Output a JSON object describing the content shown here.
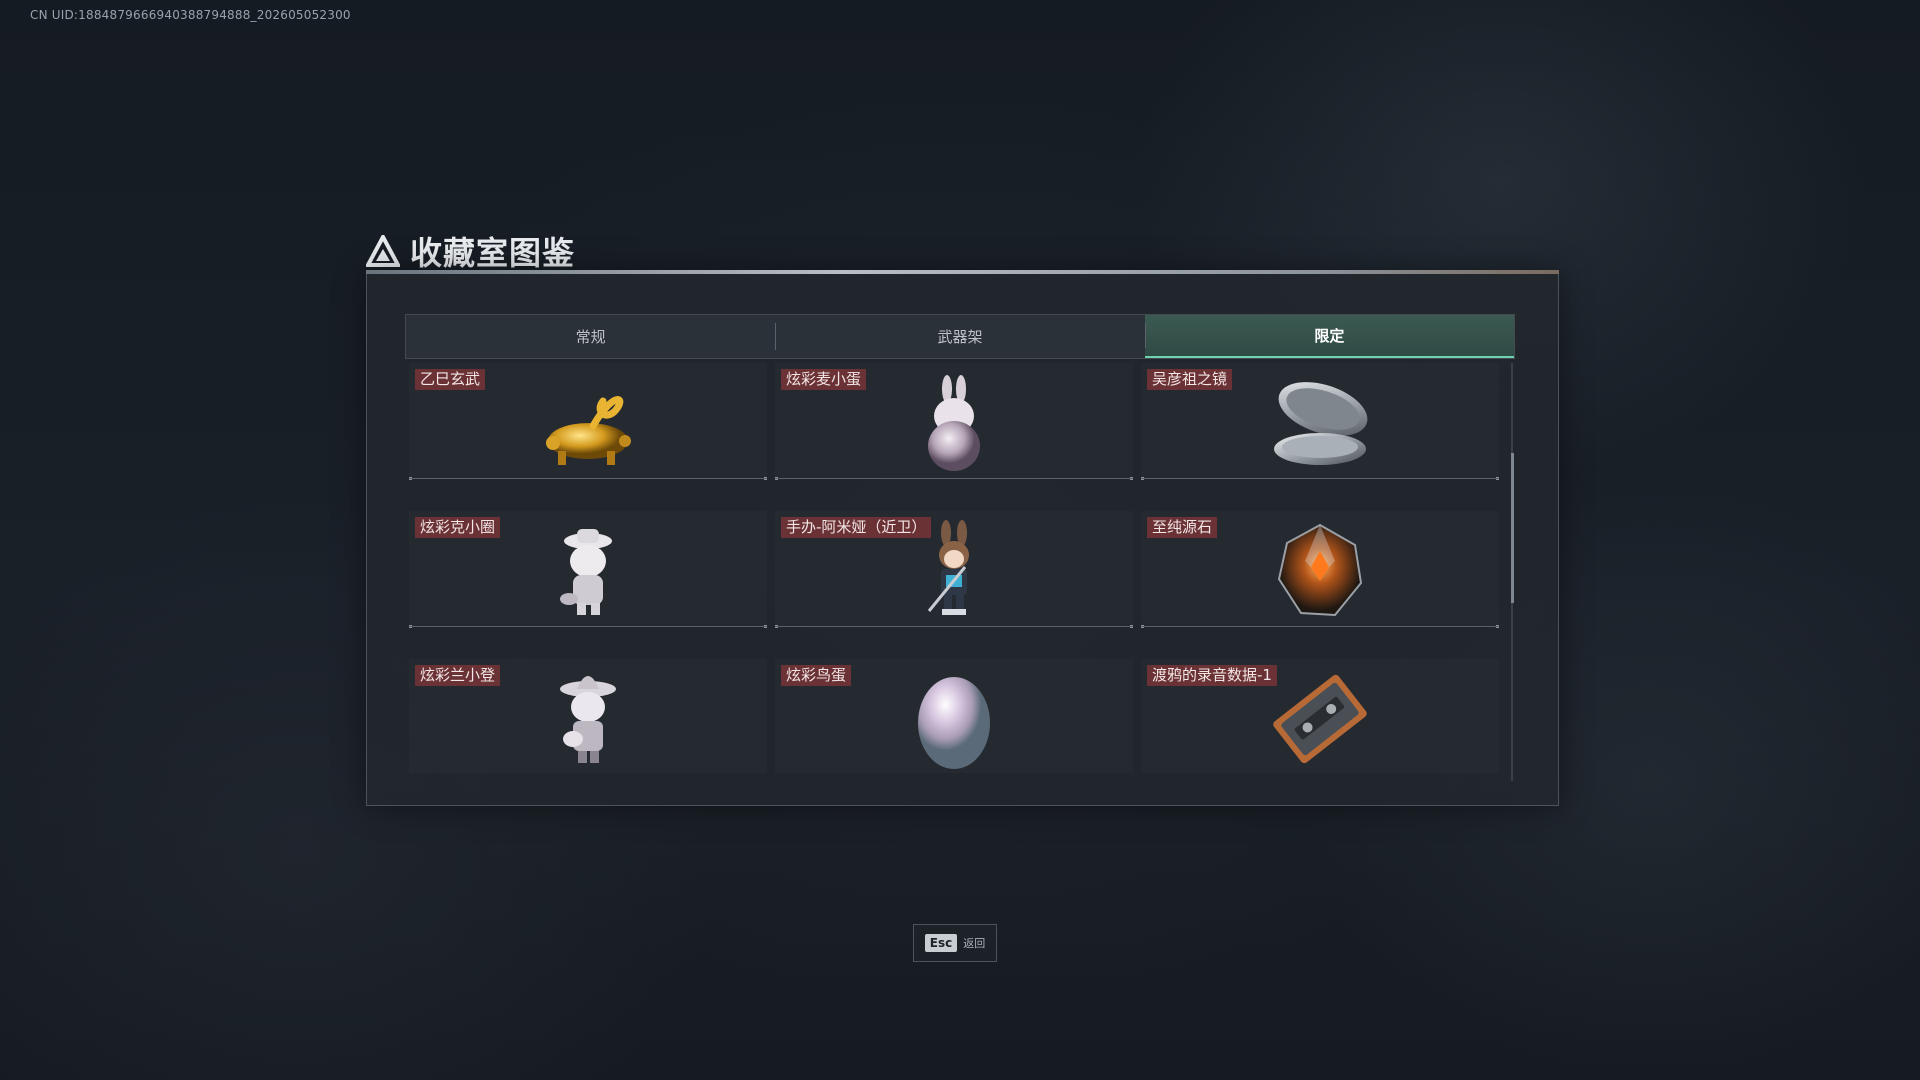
{
  "uid_text": "CN UID:1884879666940388794888_202605052300",
  "title": "收藏室图鉴",
  "tabs": [
    {
      "label": "常规",
      "active": false
    },
    {
      "label": "武器架",
      "active": false
    },
    {
      "label": "限定",
      "active": true
    }
  ],
  "items": [
    {
      "label": "乙巳玄武",
      "icon": "golden-serpent-tortoise-icon"
    },
    {
      "label": "炫彩麦小蛋",
      "icon": "bunny-egg-figure-icon"
    },
    {
      "label": "吴彦祖之镜",
      "icon": "compact-mirror-icon"
    },
    {
      "label": "炫彩克小圈",
      "icon": "hat-figure-icon"
    },
    {
      "label": "手办-阿米娅（近卫）",
      "icon": "amiya-figure-icon"
    },
    {
      "label": "至纯源石",
      "icon": "originium-crystal-icon"
    },
    {
      "label": "炫彩兰小登",
      "icon": "sombrero-figure-icon"
    },
    {
      "label": "炫彩鸟蛋",
      "icon": "iridescent-egg-icon"
    },
    {
      "label": "渡鸦的录音数据-1",
      "icon": "cassette-tape-icon"
    }
  ],
  "footer": {
    "key": "Esc",
    "label": "返回"
  },
  "colors": {
    "tag_bg": "#6b3236",
    "active_tab": "#2f4a44",
    "active_underline": "#6fd1b0"
  }
}
